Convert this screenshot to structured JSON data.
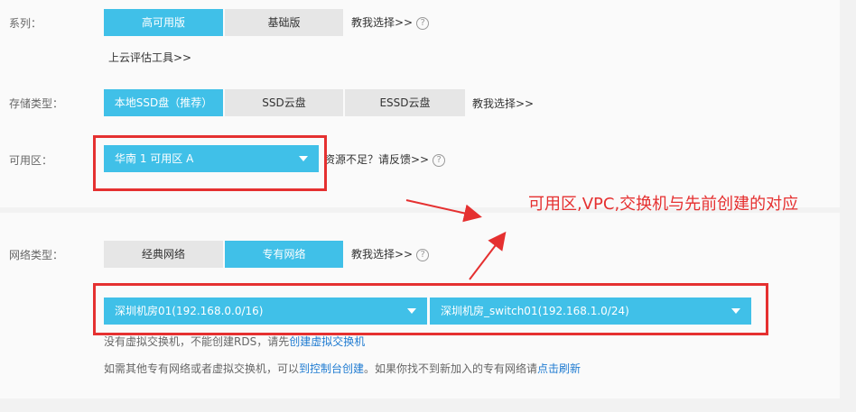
{
  "series": {
    "label": "系列：",
    "options": [
      "高可用版",
      "基础版"
    ],
    "selected": 0,
    "help_link": "教我选择>>",
    "help_icon": "question-circle-icon",
    "estimate_link": "上云评估工具>>"
  },
  "storage": {
    "label": "存储类型：",
    "options": [
      "本地SSD盘（推荐）",
      "SSD云盘",
      "ESSD云盘"
    ],
    "selected": 0,
    "help_link": "教我选择>>"
  },
  "zone": {
    "label": "可用区：",
    "value": "华南 1 可用区 A",
    "insufficient_link": "资源不足？请反馈>>",
    "help_icon": "question-circle-icon"
  },
  "annotation": {
    "text": "可用区,VPC,交换机与先前创建的对应",
    "color": "#e53030"
  },
  "network": {
    "label": "网络类型：",
    "options": [
      "经典网络",
      "专有网络"
    ],
    "selected": 1,
    "help_link": "教我选择>>",
    "help_icon": "question-circle-icon",
    "vpc_value": "深圳机房01(192.168.0.0/16)",
    "switch_value": "深圳机房_switch01(192.168.1.0/24)",
    "no_switch_text": "没有虚拟交换机，不能创建RDS，请先",
    "no_switch_link": "创建虚拟交换机",
    "hint_prefix": "如需其他专有网络或者虚拟交换机，可以",
    "hint_console_link": "到控制台创建",
    "hint_middle": "。如果你找不到新加入的专有网络请",
    "hint_refresh_link": "点击刷新"
  },
  "colors": {
    "accent": "#40c0e8",
    "link": "#1f7bd1",
    "highlight": "#e53030"
  }
}
